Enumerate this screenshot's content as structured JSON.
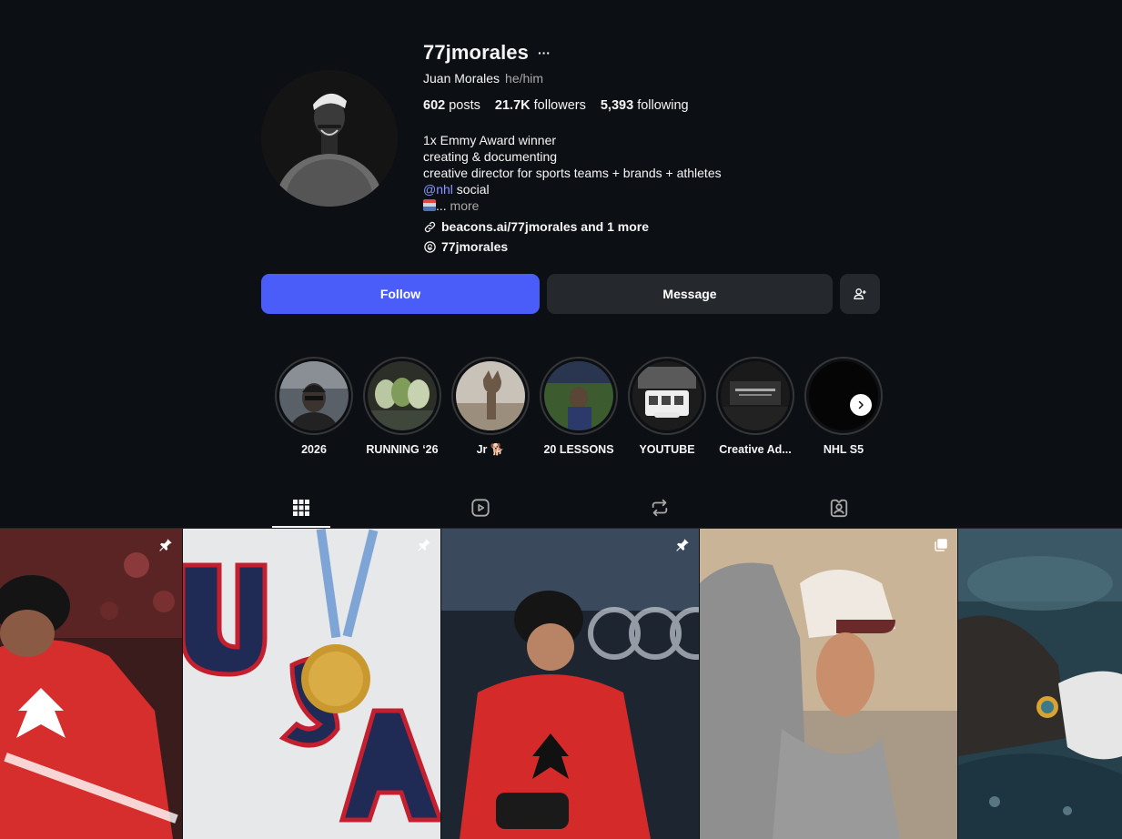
{
  "profile": {
    "username": "77jmorales",
    "more_label": "···",
    "full_name": "Juan Morales",
    "pronouns": "he/him",
    "stats": {
      "posts_count": "602",
      "posts_label": "posts",
      "followers_count": "21.7K",
      "followers_label": "followers",
      "following_count": "5,393",
      "following_label": "following"
    },
    "bio": {
      "line1": "1x Emmy Award winner",
      "line2": "creating & documenting",
      "line3": "creative director for sports teams + brands + athletes",
      "mention": "@nhl",
      "line4_suffix": " social",
      "line5_dots": "...",
      "more": " more"
    },
    "link_text": "beacons.ai/77jmorales and 1 more",
    "threads_handle": "77jmorales"
  },
  "actions": {
    "follow": "Follow",
    "message": "Message"
  },
  "highlights": [
    {
      "label": "2026"
    },
    {
      "label": "RUNNING ‘26"
    },
    {
      "label": "Jr 🐕"
    },
    {
      "label": "20 LESSONS"
    },
    {
      "label": "YOUTUBE"
    },
    {
      "label": "Creative Ad..."
    },
    {
      "label": "NHL S5"
    }
  ],
  "tabs": [
    "posts-grid-icon",
    "reels-icon",
    "reposts-icon",
    "tagged-icon"
  ],
  "posts": [
    {
      "pinned": true,
      "icon": "pin-icon"
    },
    {
      "pinned": true,
      "icon": "pin-icon"
    },
    {
      "pinned": true,
      "icon": "pin-icon"
    },
    {
      "pinned": false,
      "icon": "carousel-icon"
    },
    {
      "pinned": false,
      "icon": ""
    }
  ],
  "colors": {
    "background": "#0c1014",
    "follow_button": "#4a5df9",
    "secondary_button": "#25292e",
    "mention": "#8a97ff"
  }
}
